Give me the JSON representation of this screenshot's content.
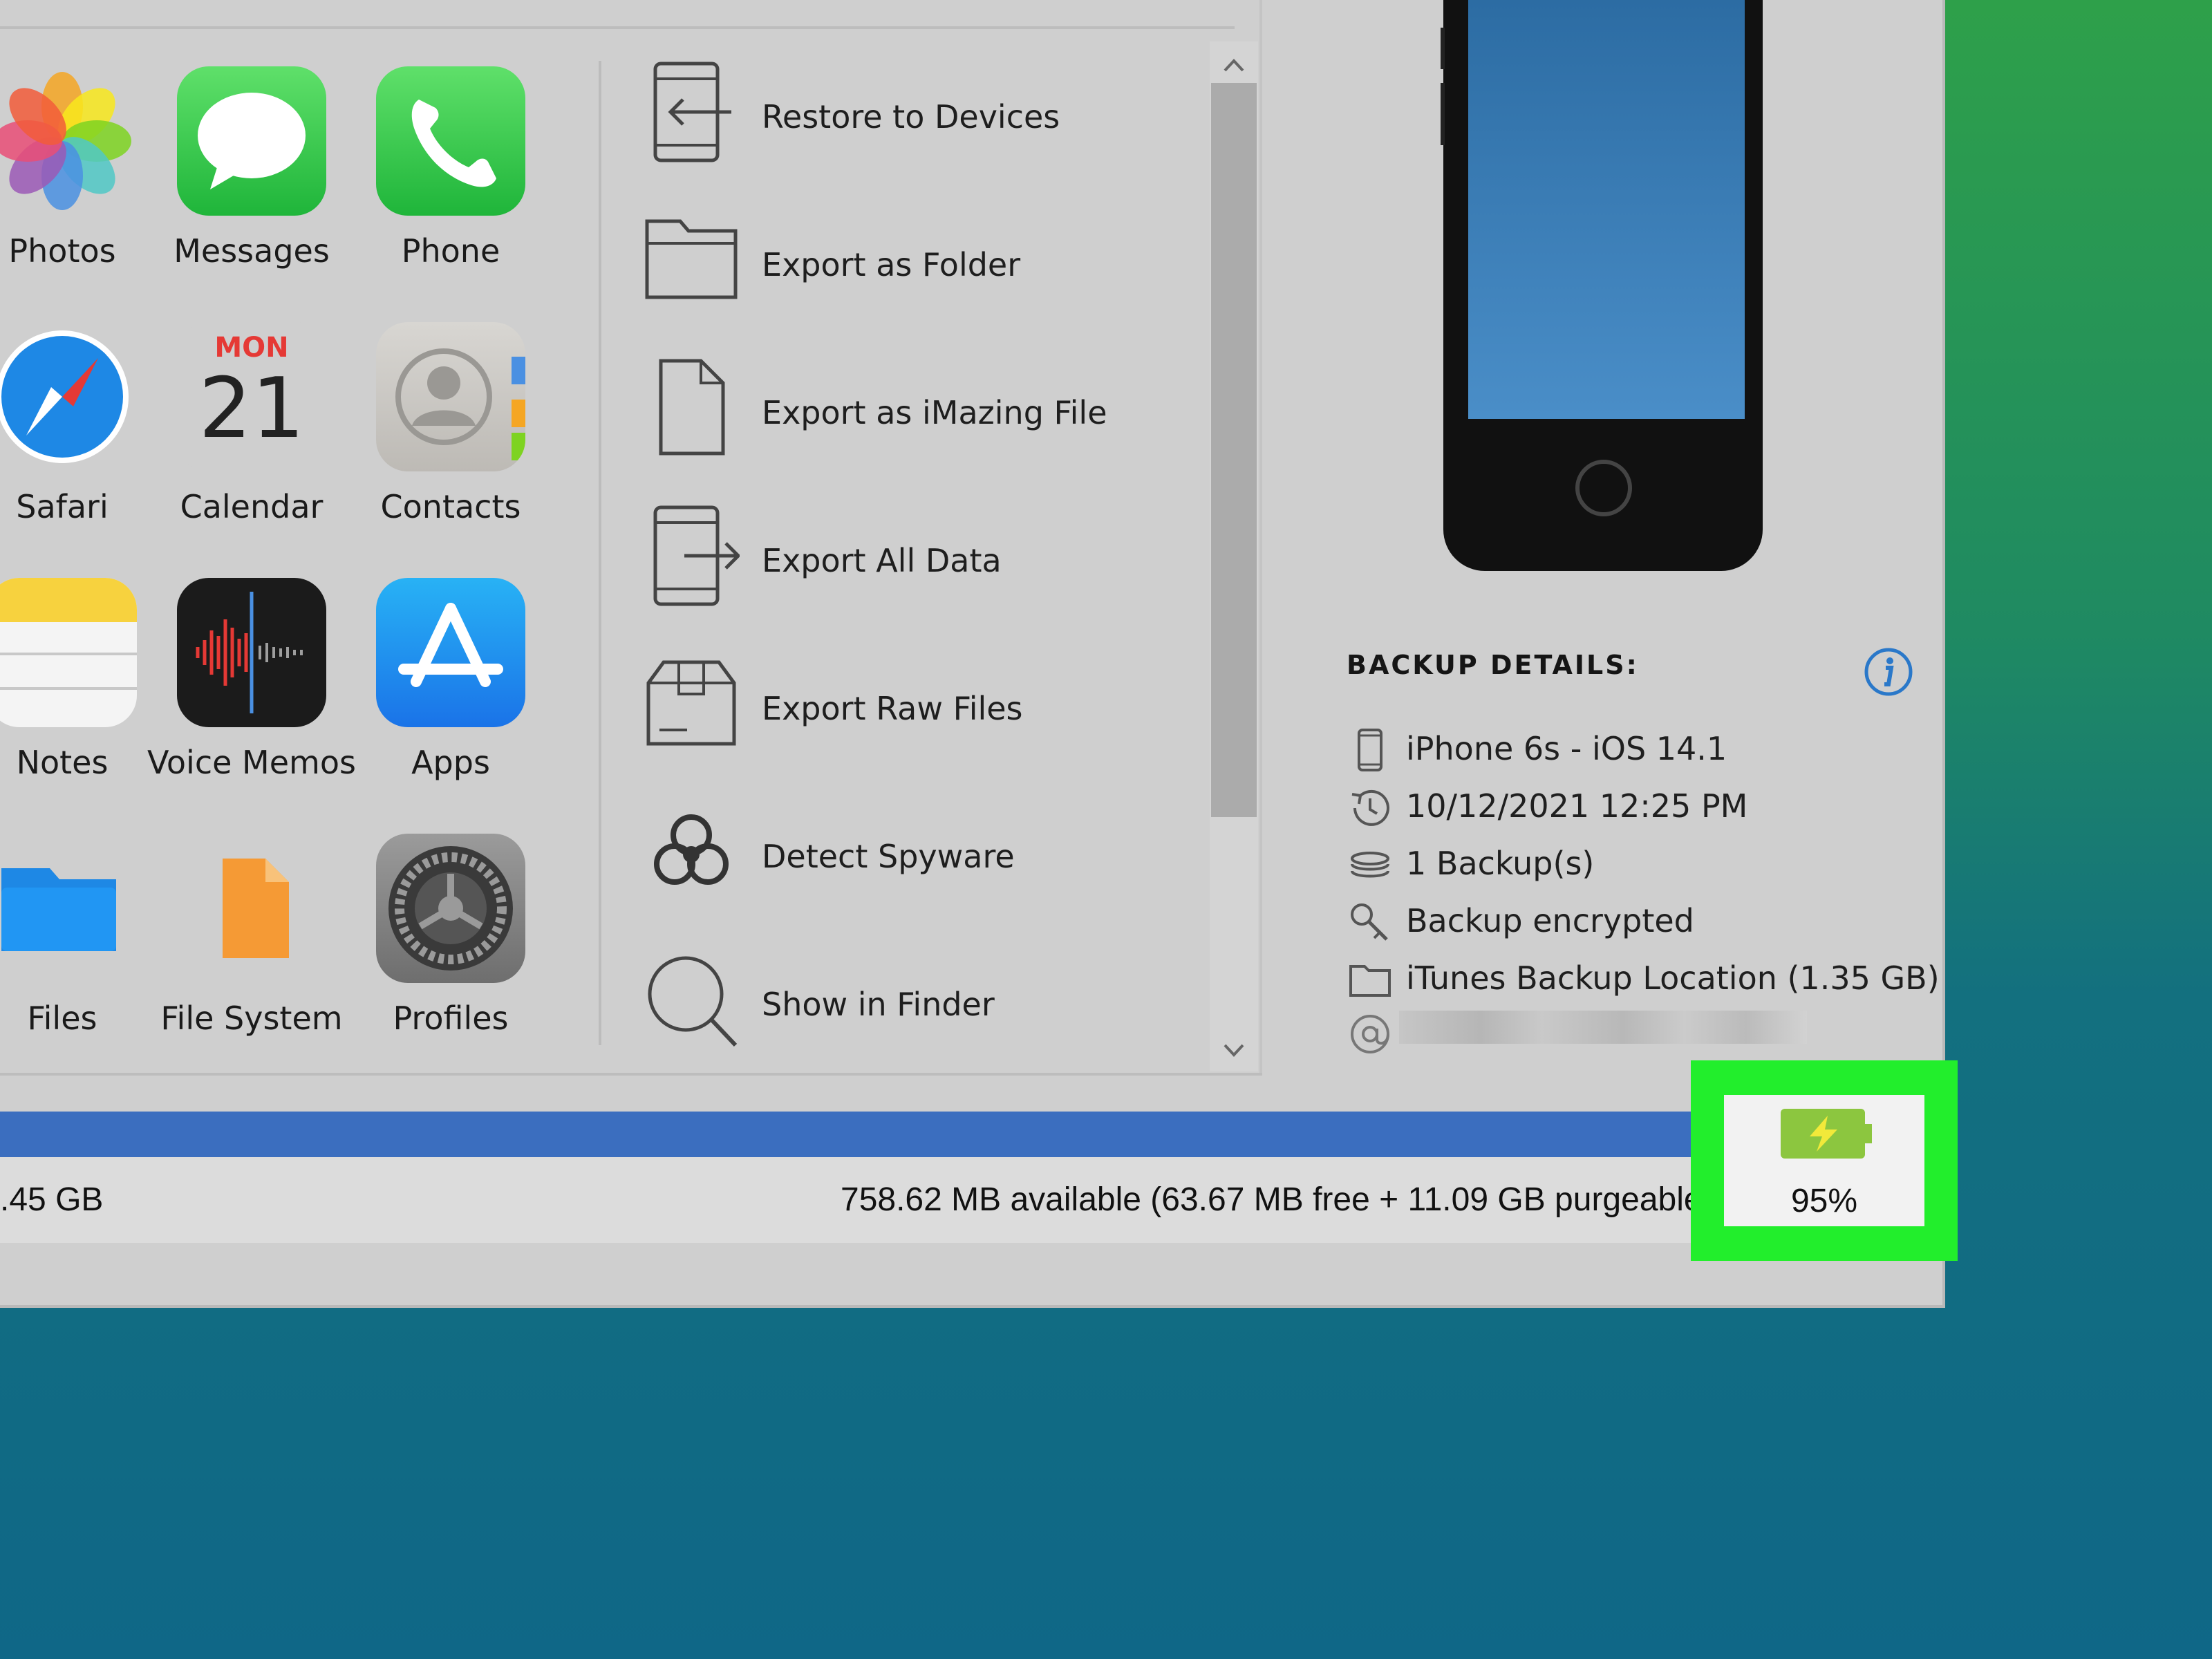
{
  "apps": [
    {
      "label": "Photos",
      "icon": "photos-icon"
    },
    {
      "label": "Messages",
      "icon": "messages-icon"
    },
    {
      "label": "Phone",
      "icon": "phone-icon"
    },
    {
      "label": "Safari",
      "icon": "safari-icon"
    },
    {
      "label": "Calendar",
      "icon": "calendar-icon",
      "calendar_day": "MON",
      "calendar_date": "21"
    },
    {
      "label": "Contacts",
      "icon": "contacts-icon"
    },
    {
      "label": "Notes",
      "icon": "notes-icon"
    },
    {
      "label": "Voice Memos",
      "icon": "voice-memos-icon"
    },
    {
      "label": "Apps",
      "icon": "app-store-icon"
    },
    {
      "label": "Files",
      "icon": "files-icon"
    },
    {
      "label": "File System",
      "icon": "file-system-icon"
    },
    {
      "label": "Profiles",
      "icon": "settings-gear-icon"
    }
  ],
  "actions": [
    {
      "label": "Restore to Devices",
      "icon": "restore-device-icon"
    },
    {
      "label": "Export as Folder",
      "icon": "folder-icon"
    },
    {
      "label": "Export as iMazing File",
      "icon": "file-icon"
    },
    {
      "label": "Export All Data",
      "icon": "export-device-icon"
    },
    {
      "label": "Export Raw Files",
      "icon": "box-icon"
    },
    {
      "label": "Detect Spyware",
      "icon": "biohazard-icon"
    },
    {
      "label": "Show in Finder",
      "icon": "magnifier-icon"
    }
  ],
  "backup_details": {
    "title": "BACKUP DETAILS:",
    "device": "iPhone 6s - iOS 14.1",
    "date": "10/12/2021 12:25 PM",
    "backups": "1 Backup(s)",
    "encrypted": "Backup encrypted",
    "location": "iTunes Backup Location (1.35 GB)"
  },
  "storage": {
    "total": ".45 GB",
    "available": "758.62 MB available (63.67 MB free + 11.09 GB purgeable"
  },
  "battery": {
    "percent": "95%",
    "level": 0.95
  },
  "colors": {
    "accent_bar": "#3b6ebf",
    "highlight": "#22ee2c",
    "battery": "#8cc63f"
  }
}
